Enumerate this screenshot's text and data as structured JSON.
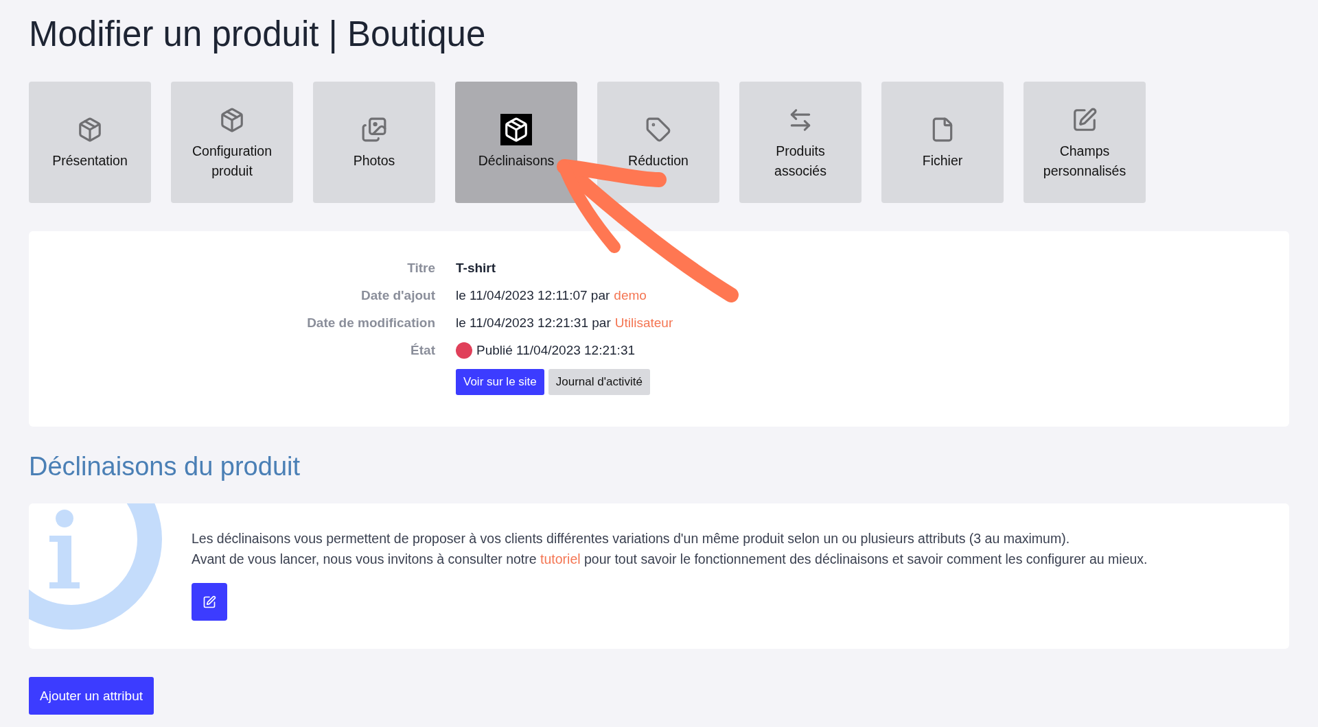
{
  "page_title": "Modifier un produit | Boutique",
  "tabs": [
    {
      "label": "Présentation",
      "selected": false
    },
    {
      "label": "Configuration produit",
      "selected": false
    },
    {
      "label": "Photos",
      "selected": false
    },
    {
      "label": "Déclinaisons",
      "selected": true
    },
    {
      "label": "Réduction",
      "selected": false
    },
    {
      "label": "Produits associés",
      "selected": false
    },
    {
      "label": "Fichier",
      "selected": false
    },
    {
      "label": "Champs personnalisés",
      "selected": false
    }
  ],
  "details": [
    {
      "kind": "bold",
      "label": "Titre",
      "value": "T-shirt"
    },
    {
      "kind": "link",
      "label": "Date d'ajout",
      "value": "le 11/04/2023 12:11:07 par",
      "link": "demo"
    },
    {
      "kind": "link",
      "label": "Date de modification",
      "value": "le 11/04/2023 12:21:31 par",
      "link": "Utilisateur"
    },
    {
      "kind": "status",
      "label": "État",
      "value": "Publié 11/04/2023 12:21:31",
      "color": "#e0405a"
    }
  ],
  "detail_buttons": [
    {
      "label": "Voir sur le site",
      "kind": "primary"
    },
    {
      "label": "Journal d'activité",
      "kind": "secondary"
    }
  ],
  "section_title": "Déclinaisons du produit",
  "info": {
    "lines": [
      {
        "text": "Les déclinaisons vous permettent de proposer à vos clients différentes variations d'un même produit selon un ou plusieurs attributs (3 au maximum)."
      },
      {
        "text": "Avant de vous lancer, nous vous invitons à consulter notre",
        "link": "tutoriel",
        "after": "pour tout savoir le fonctionnement des déclinaisons et savoir comment les configurer au mieux."
      }
    ]
  },
  "add_button": "Ajouter un attribut"
}
